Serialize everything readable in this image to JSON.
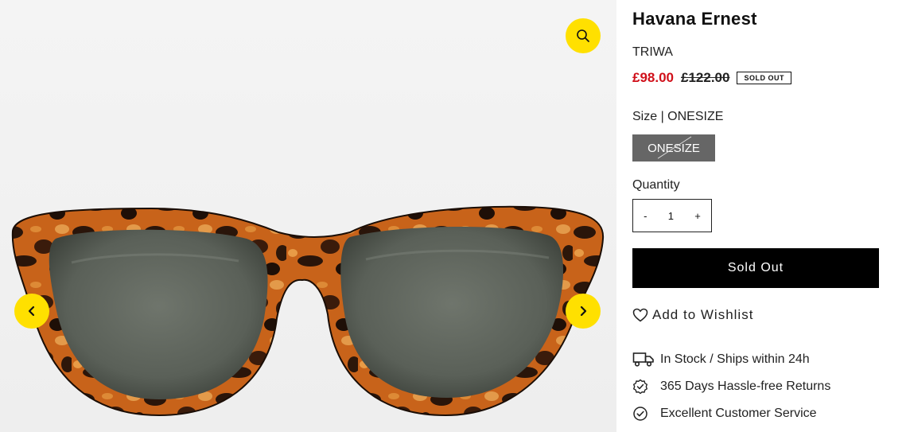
{
  "product": {
    "title": "Havana Ernest",
    "brand": "TRIWA",
    "price_sale": "£98.00",
    "price_original": "£122.00",
    "badge": "SOLD OUT",
    "size_label": "Size | ONESIZE",
    "size_option": "ONESIZE",
    "quantity_label": "Quantity",
    "quantity_minus": "-",
    "quantity_value": "1",
    "quantity_plus": "+",
    "button_label": "Sold Out",
    "wishlist_label": "Add to Wishlist"
  },
  "features": [
    {
      "icon": "truck-icon",
      "label": "In Stock / Ships within 24h"
    },
    {
      "icon": "badge-check-icon",
      "label": "365 Days Hassle-free Returns"
    },
    {
      "icon": "circle-check-icon",
      "label": "Excellent Customer Service"
    }
  ],
  "colors": {
    "accent_yellow": "#ffe000",
    "sale_red": "#d0101a",
    "button_black": "#000000",
    "size_disabled": "#666666",
    "gallery_bg": "#f3f3f3"
  }
}
